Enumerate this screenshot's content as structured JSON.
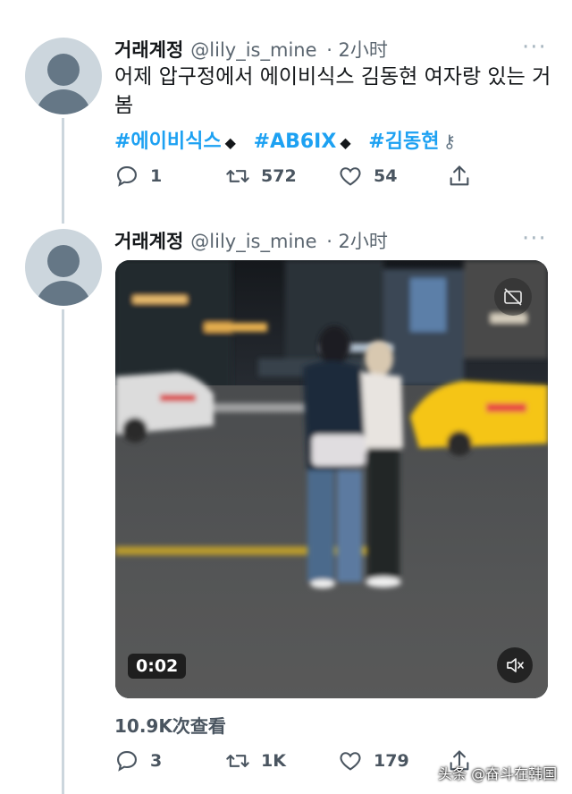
{
  "tweet1": {
    "display_name": "거래계정",
    "handle": "@lily_is_mine",
    "time": "· 2小时",
    "more_icon": "more-dots-icon",
    "text": "어제 압구정에서 에이비식스 김동현 여자랑 있는 거 봄",
    "hashtags": [
      "#에이비식스",
      "#AB6IX",
      "#김동현"
    ],
    "reply_count": "1",
    "retweet_count": "572",
    "like_count": "54"
  },
  "tweet2": {
    "display_name": "거래계정",
    "handle": "@lily_is_mine",
    "time": "· 2小时",
    "video_time": "0:02",
    "views": "10.9K次查看",
    "reply_count": "3",
    "retweet_count": "1K",
    "like_count": "179"
  },
  "watermark": "头条 @奋斗在韩国",
  "colors": {
    "link": "#1da1f2",
    "thread": "#ccd6dd",
    "avatar": "#ccd6dd",
    "muted": "#657786",
    "taxi": "#f5c518"
  }
}
